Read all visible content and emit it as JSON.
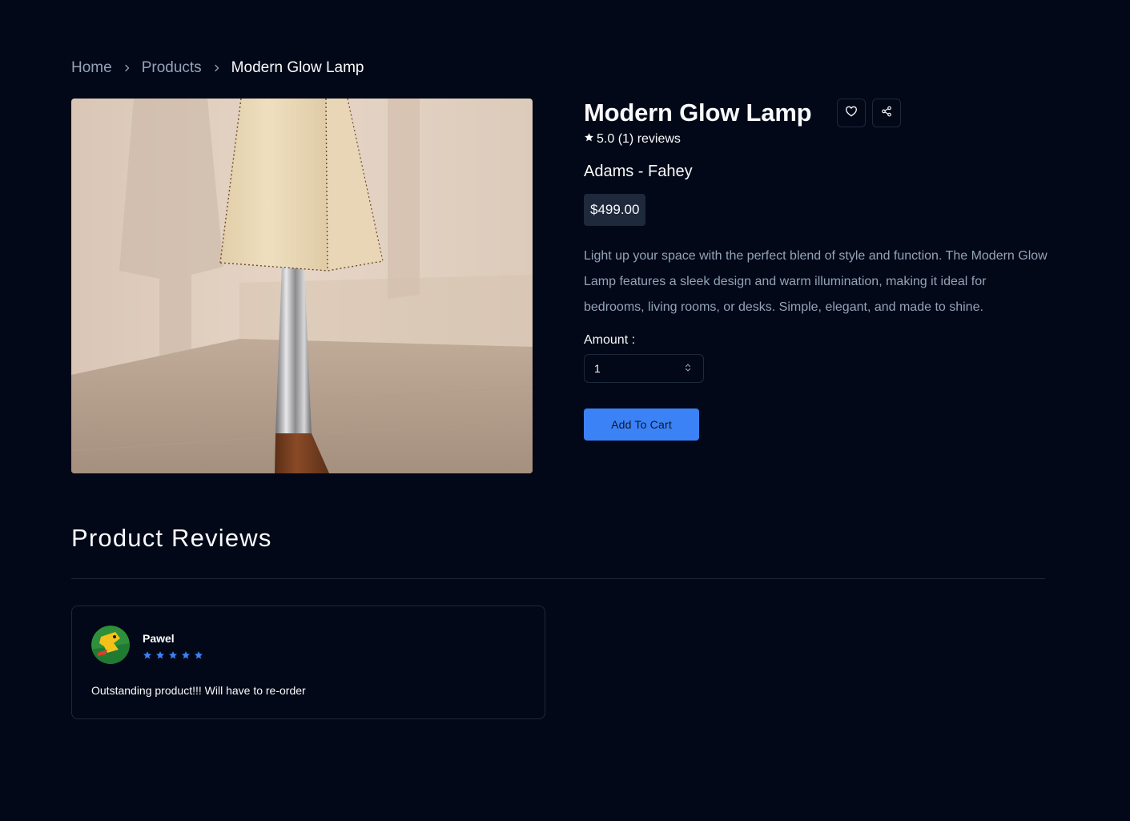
{
  "breadcrumb": {
    "home": "Home",
    "products": "Products",
    "current": "Modern Glow Lamp"
  },
  "product": {
    "title": "Modern Glow Lamp",
    "rating_text": "5.0 (1) reviews",
    "company": "Adams - Fahey",
    "price": "$499.00",
    "description": "Light up your space with the perfect blend of style and function. The Modern Glow Lamp features a sleek design and warm illumination, making it ideal for bedrooms, living rooms, or desks. Simple, elegant, and made to shine.",
    "amount_label": "Amount :",
    "amount_value": "1",
    "add_to_cart": "Add To Cart"
  },
  "icons": {
    "favorite": "heart-icon",
    "share": "share-icon",
    "rating_star": "star-icon",
    "select_chevrons": "chevrons-up-down-icon"
  },
  "reviews": {
    "heading": "Product Reviews",
    "items": [
      {
        "name": "Pawel",
        "stars": 5,
        "text": "Outstanding product!!! Will have to re-order"
      }
    ]
  },
  "colors": {
    "background": "#020817",
    "accent": "#3b82f6",
    "border": "#1e293b",
    "muted_text": "#94a3b8"
  }
}
